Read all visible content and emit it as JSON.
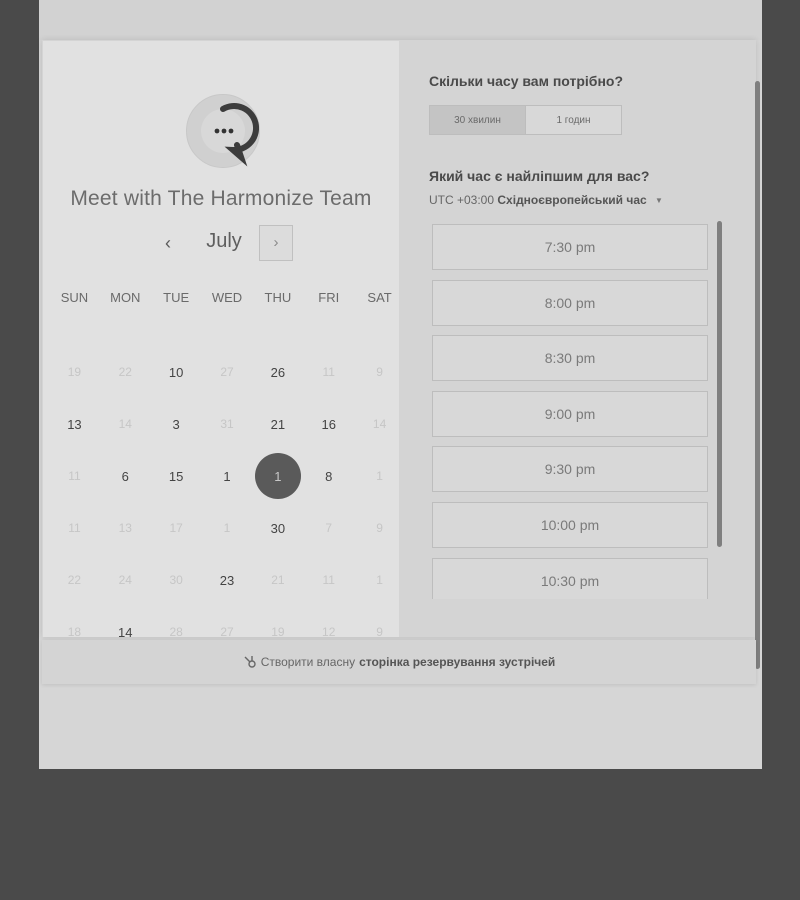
{
  "organizer": {
    "title": "Meet with The Harmonize Team",
    "avatar_icon": "chat-dots-icon"
  },
  "calendar": {
    "month": "July",
    "prev_icon": "‹",
    "next_icon": "›",
    "weekdays": [
      "SUN",
      "MON",
      "TUE",
      "WED",
      "THU",
      "FRI",
      "SAT"
    ],
    "weeks": [
      [
        {
          "d": "19",
          "active": false
        },
        {
          "d": "22",
          "active": false
        },
        {
          "d": "10",
          "active": true
        },
        {
          "d": "27",
          "active": false
        },
        {
          "d": "26",
          "active": true
        },
        {
          "d": "11",
          "active": false
        },
        {
          "d": "9",
          "active": false
        }
      ],
      [
        {
          "d": "13",
          "active": true
        },
        {
          "d": "14",
          "active": false
        },
        {
          "d": "3",
          "active": true
        },
        {
          "d": "31",
          "active": false
        },
        {
          "d": "21",
          "active": true
        },
        {
          "d": "16",
          "active": true
        },
        {
          "d": "14",
          "active": false
        }
      ],
      [
        {
          "d": "11",
          "active": false
        },
        {
          "d": "6",
          "active": true
        },
        {
          "d": "15",
          "active": true
        },
        {
          "d": "1",
          "active": true
        },
        {
          "d": "1",
          "active": true,
          "selected": true
        },
        {
          "d": "8",
          "active": true
        },
        {
          "d": "1",
          "active": false
        }
      ],
      [
        {
          "d": "11",
          "active": false
        },
        {
          "d": "13",
          "active": false
        },
        {
          "d": "17",
          "active": false
        },
        {
          "d": "1",
          "active": false
        },
        {
          "d": "30",
          "active": true
        },
        {
          "d": "7",
          "active": false
        },
        {
          "d": "9",
          "active": false
        }
      ],
      [
        {
          "d": "22",
          "active": false
        },
        {
          "d": "24",
          "active": false
        },
        {
          "d": "30",
          "active": false
        },
        {
          "d": "23",
          "active": true
        },
        {
          "d": "21",
          "active": false
        },
        {
          "d": "11",
          "active": false
        },
        {
          "d": "1",
          "active": false
        }
      ],
      [
        {
          "d": "18",
          "active": false
        },
        {
          "d": "14",
          "active": true
        },
        {
          "d": "28",
          "active": false
        },
        {
          "d": "27",
          "active": false
        },
        {
          "d": "19",
          "active": false
        },
        {
          "d": "12",
          "active": false
        },
        {
          "d": "9",
          "active": false
        }
      ]
    ]
  },
  "duration": {
    "question": "Скільки часу вам потрібно?",
    "options": [
      {
        "label": "30 хвилин",
        "selected": true
      },
      {
        "label": "1 годин",
        "selected": false
      }
    ]
  },
  "time": {
    "question": "Який час є найліпшим для вас?",
    "timezone_offset": "UTC +03:00",
    "timezone_name": "Східноєвропейський час",
    "slots": [
      "7:30 pm",
      "8:00 pm",
      "8:30 pm",
      "9:00 pm",
      "9:30 pm",
      "10:00 pm",
      "10:30 pm"
    ]
  },
  "footer": {
    "prefix": "Створити власну",
    "link": "сторінка резервування зустрічей",
    "icon": "hubspot-sprocket-icon"
  }
}
